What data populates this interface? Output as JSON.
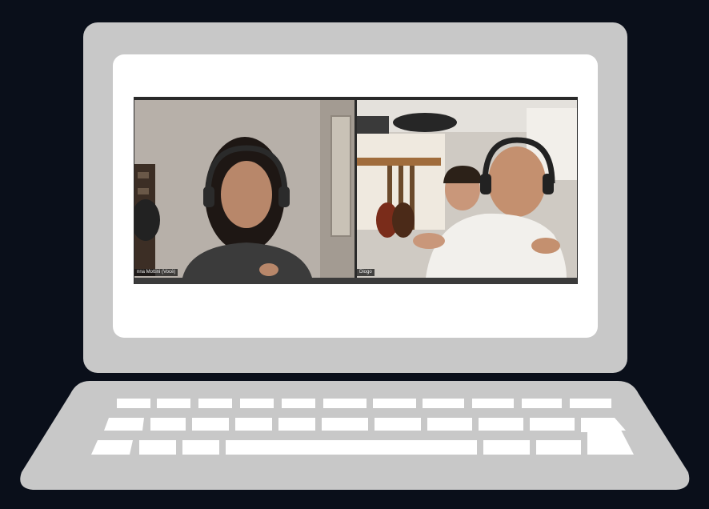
{
  "call": {
    "participants": [
      {
        "name": "nna Mottini (Vocè)"
      },
      {
        "name": "Diogo"
      }
    ]
  },
  "colors": {
    "background": "#0a0f1a",
    "laptop_body": "#c8c8c8",
    "screen": "#ffffff",
    "keys": "#ffffff"
  },
  "icons": [
    "laptop-illustration",
    "headphones-icon"
  ]
}
